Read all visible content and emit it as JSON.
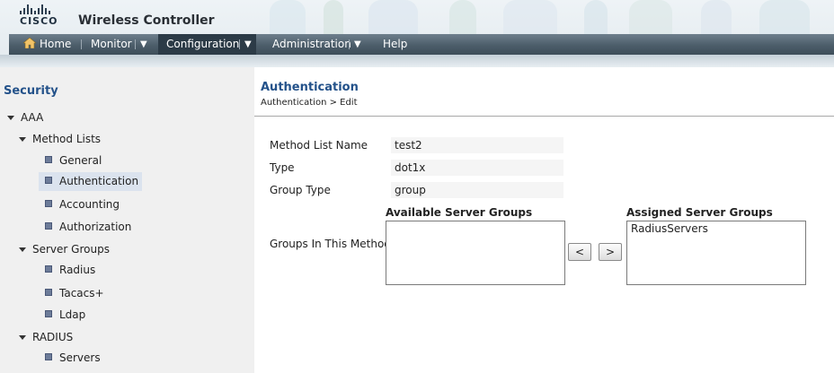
{
  "header": {
    "logo_text": "CISCO",
    "app_title": "Wireless Controller"
  },
  "nav": {
    "items": [
      {
        "label": "Home",
        "icon": "home-icon"
      },
      {
        "label": "Monitor"
      },
      {
        "label": "Configuration",
        "active": true
      },
      {
        "label": "Administration"
      },
      {
        "label": "Help"
      }
    ],
    "caret": "▼"
  },
  "sidebar": {
    "title": "Security",
    "tree": [
      {
        "label": "AAA",
        "expanded": true
      },
      {
        "label": "Method Lists",
        "expanded": true
      },
      {
        "label": "General"
      },
      {
        "label": "Authentication",
        "selected": true
      },
      {
        "label": "Accounting"
      },
      {
        "label": "Authorization"
      },
      {
        "label": "Server Groups",
        "expanded": true
      },
      {
        "label": "Radius"
      },
      {
        "label": "Tacacs+"
      },
      {
        "label": "Ldap"
      },
      {
        "label": "RADIUS",
        "expanded": true
      },
      {
        "label": "Servers"
      }
    ]
  },
  "main": {
    "title": "Authentication",
    "breadcrumb": "Authentication > Edit",
    "fields": [
      {
        "label": "Method List Name",
        "value": "test2"
      },
      {
        "label": "Type",
        "value": "dot1x"
      },
      {
        "label": "Group Type",
        "value": "group"
      }
    ],
    "groups_label": "Groups In This Method",
    "available": {
      "header": "Available Server Groups",
      "options": []
    },
    "assigned": {
      "header": "Assigned Server Groups",
      "options": [
        "RadiusServers"
      ]
    },
    "move_left_label": "<",
    "move_right_label": ">"
  },
  "colors": {
    "accent_title": "#24528a",
    "nav_bar": "#4c5d6a",
    "nav_active": "#2c3b47",
    "sidebar_bg": "#f0f0f0"
  }
}
